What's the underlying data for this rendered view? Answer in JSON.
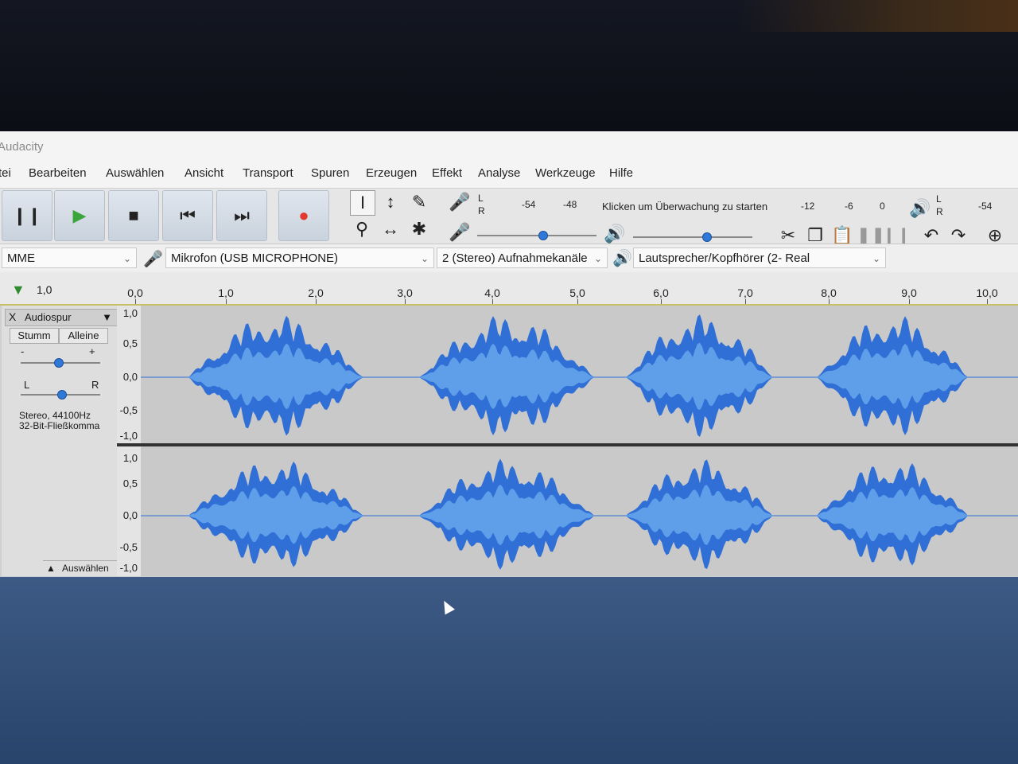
{
  "window": {
    "title": "Audacity"
  },
  "menu": [
    "Datei",
    "Bearbeiten",
    "Auswählen",
    "Ansicht",
    "Transport",
    "Spuren",
    "Erzeugen",
    "Effekt",
    "Analyse",
    "Werkzeuge",
    "Hilfe"
  ],
  "menu_visible": [
    "tei",
    "Bearbeiten",
    "Auswählen",
    "Ansicht",
    "Transport",
    "Spuren",
    "Erzeugen",
    "Effekt",
    "Analyse",
    "Werkzeuge",
    "Hilfe"
  ],
  "transport": {
    "icons": [
      "pause-icon",
      "play-icon",
      "stop-icon",
      "skip-start-icon",
      "skip-end-icon",
      "record-icon"
    ]
  },
  "tools": {
    "icons": [
      "selection-tool-icon",
      "envelope-tool-icon",
      "draw-tool-icon",
      "zoom-tool-icon",
      "timeshift-tool-icon",
      "multi-tool-icon"
    ]
  },
  "recording_meter": {
    "lr_top": "L",
    "lr_bottom": "R",
    "ticks": [
      "-54",
      "-48"
    ],
    "monitor_text": "Klicken um Überwachung zu starten",
    "ticks_right": [
      "-12",
      "-6",
      "0"
    ]
  },
  "playback_meter": {
    "lr_top": "L",
    "lr_bottom": "R",
    "tick": "-54"
  },
  "edit_icons": [
    "cut-icon",
    "copy-icon",
    "paste-icon",
    "trim-icon",
    "silence-icon",
    "undo-icon",
    "redo-icon",
    "zoom-in-icon"
  ],
  "devices": {
    "host": "MME",
    "mic": "Mikrofon (USB MICROPHONE)",
    "channels": "2 (Stereo) Aufnahmekanäle",
    "speaker": "Lautsprecher/Kopfhörer (2- Real"
  },
  "ruler": {
    "play_head_label": "1,0",
    "ticks": [
      "0,0",
      "1,0",
      "2,0",
      "3,0",
      "4,0",
      "5,0",
      "6,0",
      "7,0",
      "8,0",
      "9,0",
      "10,0"
    ]
  },
  "track": {
    "close": "X",
    "name": "Audiospur",
    "mute": "Stumm",
    "solo": "Alleine",
    "gain_minus": "-",
    "gain_plus": "+",
    "pan_left": "L",
    "pan_right": "R",
    "info_line1": "Stereo, 44100Hz",
    "info_line2": "32-Bit-Fließkomma",
    "select": "Auswählen"
  },
  "vscale": {
    "top": [
      "1,0",
      "0,5",
      "0,0",
      "-0,5",
      "-1,0"
    ],
    "bottom": [
      "1,0",
      "0,5",
      "0,0",
      "-0,5",
      "-1,0"
    ]
  },
  "colors": {
    "wave_outer": "#2f6fd6",
    "wave_inner": "#5f9ee8",
    "track_bg": "#c9c9c9",
    "record": "#e03a2f",
    "play": "#3aa53a"
  }
}
